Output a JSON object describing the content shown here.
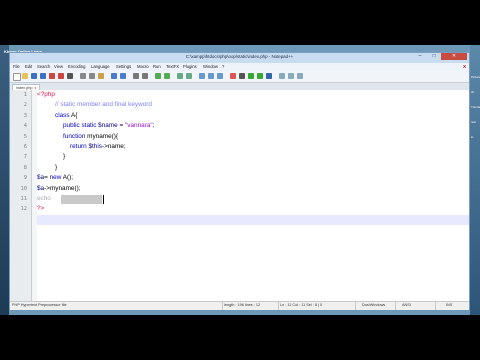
{
  "watermark": "Khmer Online Learn",
  "window": {
    "title": "C:\\xampp\\htdocs\\php\\oop\\static\\index.php - Notepad++",
    "min_glyph": "–",
    "max_glyph": "□",
    "close_glyph": "✕"
  },
  "menu": [
    "File",
    "Edit",
    "Search",
    "View",
    "Encoding",
    "Language",
    "Settings",
    "Macro",
    "Run",
    "TextFX",
    "Plugins",
    "Window",
    "?"
  ],
  "menu_close": "X",
  "tab": {
    "label": "index.php",
    "close": "x"
  },
  "code": {
    "line_numbers": [
      "1",
      "2",
      "3",
      "4",
      "5",
      "6",
      "7",
      "8",
      "9",
      "10",
      "11",
      "12"
    ],
    "l1": "<?php",
    "l2": "// static member and final keyword",
    "l3_kw": "class",
    "l3_rest": " A{",
    "l4_kw": "public static",
    "l4_var": " $name",
    "l4_op": " = ",
    "l4_str": "\"vannara\"",
    "l4_end": ";",
    "l5_kw": "function",
    "l5_rest": " myname(){",
    "l6_kw": "return",
    "l6_var": " $this",
    "l6_rest": "->name;",
    "l7": "}",
    "l8": "}",
    "l9_var": "$a",
    "l9_op": "= ",
    "l9_kw": "new",
    "l9_rest": " A();",
    "l10_var": "$a",
    "l10_rest": "->myname();",
    "l11_var": "echo",
    "l12": "?>"
  },
  "status": {
    "language": "PHP Hypertext Preprocessor file",
    "length": "length : 196   lines : 12",
    "position": "Ln : 11   Col : 11   Sel : 8 | 0",
    "eol": "Dos\\Windows",
    "encoding": "ANSI",
    "mode": "INS"
  },
  "desktop_right_labels": [
    "Pictures",
    "sh",
    "Tutorial",
    "test",
    "in"
  ]
}
